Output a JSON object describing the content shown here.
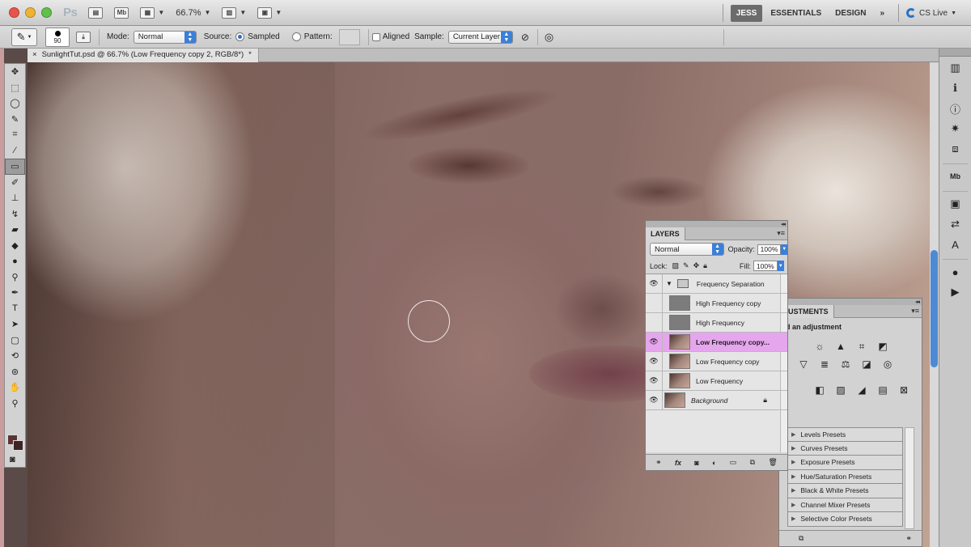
{
  "appbar": {
    "logo": "Ps",
    "mini_bridge": "Mb",
    "zoom": "66.7%",
    "workspace_active": "JESS",
    "workspace_essentials": "ESSENTIALS",
    "workspace_design": "DESIGN",
    "more": "»",
    "cs_live": "CS Live",
    "traffic_colors": [
      "#e9534b",
      "#efb334",
      "#5fc14a"
    ]
  },
  "options": {
    "brush_size": "90",
    "mode_label": "Mode:",
    "mode_value": "Normal",
    "source_label": "Source:",
    "sampled_label": "Sampled",
    "pattern_label": "Pattern:",
    "aligned_label": "Aligned",
    "sample_label": "Sample:",
    "sample_value": "Current Layer"
  },
  "document": {
    "tab_title": "SunlightTut.psd @ 66.7% (Low Frequency copy 2, RGB/8*)",
    "close": "×",
    "modified": "*"
  },
  "toolbox": {
    "tools": [
      {
        "name": "move-tool",
        "glyph": "✥"
      },
      {
        "name": "marquee-tool",
        "glyph": "⬚"
      },
      {
        "name": "lasso-tool",
        "glyph": "◯"
      },
      {
        "name": "quick-select-tool",
        "glyph": "✎"
      },
      {
        "name": "crop-tool",
        "glyph": "⌗"
      },
      {
        "name": "eyedropper-tool",
        "glyph": "⁄"
      },
      {
        "name": "healing-brush-tool",
        "glyph": "▭",
        "selected": true
      },
      {
        "name": "brush-tool",
        "glyph": "✐"
      },
      {
        "name": "clone-stamp-tool",
        "glyph": "⊥"
      },
      {
        "name": "history-brush-tool",
        "glyph": "↯"
      },
      {
        "name": "eraser-tool",
        "glyph": "▰"
      },
      {
        "name": "paint-bucket-tool",
        "glyph": "◆"
      },
      {
        "name": "blur-tool",
        "glyph": "●"
      },
      {
        "name": "dodge-tool",
        "glyph": "⚲"
      },
      {
        "name": "pen-tool",
        "glyph": "✒"
      },
      {
        "name": "type-tool",
        "glyph": "T"
      },
      {
        "name": "path-select-tool",
        "glyph": "➤"
      },
      {
        "name": "shape-tool",
        "glyph": "▢"
      },
      {
        "name": "3d-rotate-tool",
        "glyph": "⟲"
      },
      {
        "name": "3d-orbit-tool",
        "glyph": "⊚"
      },
      {
        "name": "hand-tool",
        "glyph": "✋"
      },
      {
        "name": "zoom-tool",
        "glyph": "⚲"
      }
    ],
    "fg_color": "#5b3432",
    "bg_color": "#3e2422"
  },
  "layers_panel": {
    "tab": "LAYERS",
    "blend_mode": "Normal",
    "opacity_label": "Opacity:",
    "opacity": "100%",
    "lock_label": "Lock:",
    "fill_label": "Fill:",
    "fill": "100%",
    "layers": [
      {
        "name": "Frequency Separation",
        "type": "group",
        "visible": true
      },
      {
        "name": "High Frequency copy",
        "type": "gray",
        "visible": false
      },
      {
        "name": "High Frequency",
        "type": "gray",
        "visible": false
      },
      {
        "name": "Low Frequency copy...",
        "type": "photo",
        "visible": true,
        "selected": true
      },
      {
        "name": "Low Frequency copy",
        "type": "photo",
        "visible": true
      },
      {
        "name": "Low Frequency",
        "type": "photo",
        "visible": true
      },
      {
        "name": "Background",
        "type": "photo",
        "visible": true,
        "locked": true,
        "italic": true
      }
    ],
    "selected_color": "#e6a6ee"
  },
  "adjustments_panel": {
    "tab": "JUSTMENTS",
    "subtitle": "d an adjustment",
    "presets": [
      "Levels Presets",
      "Curves Presets",
      "Exposure Presets",
      "Hue/Saturation Presets",
      "Black & White Presets",
      "Channel Mixer Presets",
      "Selective Color Presets"
    ]
  }
}
